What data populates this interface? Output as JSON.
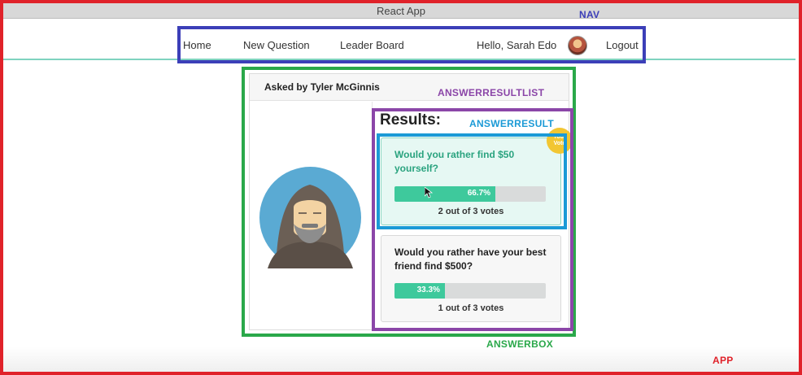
{
  "window": {
    "title": "React App"
  },
  "nav": {
    "home": "Home",
    "new_question": "New Question",
    "leader_board": "Leader Board",
    "greeting": "Hello, Sarah Edo",
    "logout": "Logout"
  },
  "question": {
    "asked_by": "Asked by Tyler McGinnis",
    "results_title": "Results:",
    "options": [
      {
        "text": "Would you rather find $50 yourself?",
        "percent_label": "66.7%",
        "percent": 66.7,
        "votes": "2 out of 3 votes",
        "your_vote": true
      },
      {
        "text": "Would you rather have your best friend find $500?",
        "percent_label": "33.3%",
        "percent": 33.3,
        "votes": "1 out of 3 votes",
        "your_vote": false
      }
    ],
    "your_vote_badge": "Your Vote"
  },
  "annotations": {
    "nav": "NAV",
    "answer_result_list": "ANSWERRESULTLIST",
    "answer_result": "ANSWERRESULT",
    "answer_box": "ANSWERBOX",
    "app": "APP"
  },
  "colors": {
    "app": "#e0222a",
    "nav": "#3c3fb8",
    "answer_box": "#2aa84a",
    "answer_result_list": "#8b46a8",
    "answer_result": "#1b9ad6",
    "progress": "#3ec99c"
  }
}
